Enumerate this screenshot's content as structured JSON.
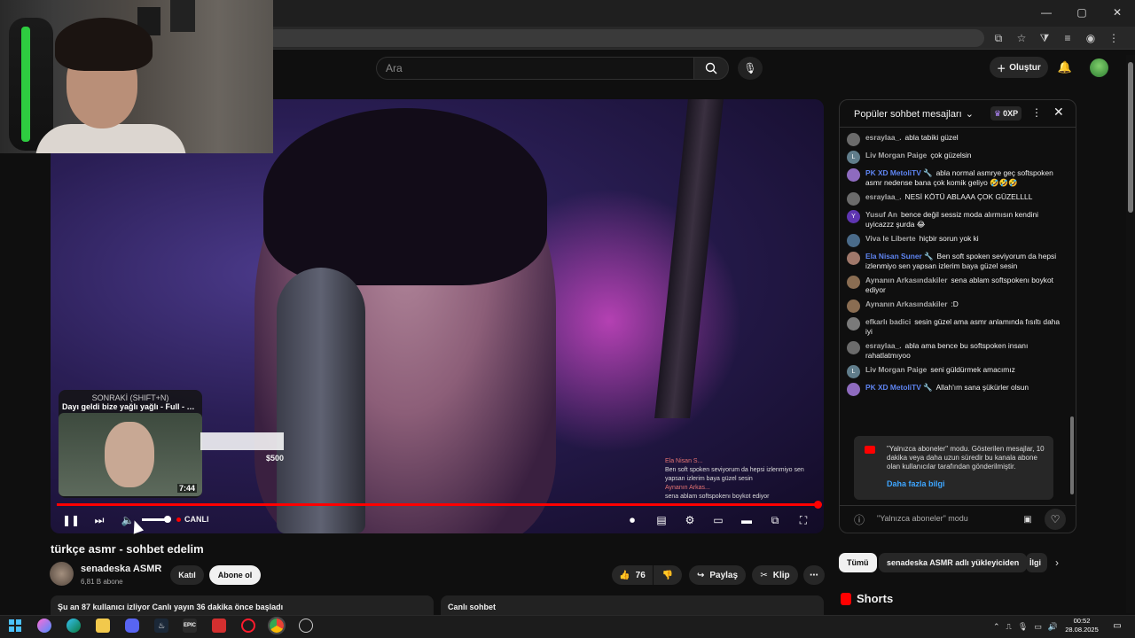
{
  "browser": {
    "window_controls": [
      "—",
      "▢",
      "✕"
    ]
  },
  "header": {
    "search_placeholder": "Ara",
    "create_label": "Oluştur"
  },
  "player": {
    "next_label": "SONRAKİ (SHIFT+N)",
    "next_title": "Dayı geldi bize yağlı yağlı - Full - Jorda...",
    "next_duration": "7:44",
    "overlay_amount": "$500",
    "overlay_ticker": [
      "Ela Nisan S...",
      "Ben soft spoken seviyorum da hepsi izlenmiyo sen yapsan izlerim baya güzel sesin",
      "Aynanın Arkas...",
      "sena ablam softspokenı boykot ediyor"
    ],
    "live_label": "CANLI",
    "progress": 1.0,
    "volume": 0.8
  },
  "video": {
    "title": "türkçe asmr - sohbet edelim",
    "channel": "senadeska ASMR",
    "subscribers": "6,81 B abone",
    "join_label": "Katıl",
    "subscribe_label": "Abone ol",
    "likes": "76",
    "share_label": "Paylaş",
    "clip_label": "Klip",
    "viewers_text": "Şu an 87 kullanıcı izliyor  Canlı yayın 36 dakika önce başladı",
    "live_chat_label": "Canlı sohbet"
  },
  "chat": {
    "title": "Popüler sohbet mesajları",
    "xp": "0XP",
    "messages": [
      {
        "author": "esraylaa_.",
        "text": "abla tabiki güzel",
        "avatar": "",
        "mod": false,
        "color": "#6b6b6b"
      },
      {
        "author": "Liv Morgan Paige",
        "text": "çok güzelsin",
        "avatar": "L",
        "mod": false,
        "color": "#607d8b"
      },
      {
        "author": "PK XD MetoliTV 🔧",
        "text": "abla normal asmrye geç softspoken asmr nedense bana çok komik geliyo 🤣🤣🤣",
        "avatar": "",
        "mod": true,
        "color": "#8e6bbf"
      },
      {
        "author": "esraylaa_.",
        "text": "NESİ KÖTÜ ABLAAA ÇOK GÜZELLLL",
        "avatar": "",
        "mod": false,
        "color": "#6b6b6b"
      },
      {
        "author": "Yusuf An",
        "text": "bence değil sessiz moda alırmısın kendini uyicazzz şurda 😂",
        "avatar": "Y",
        "mod": false,
        "color": "#5e35b1"
      },
      {
        "author": "Viva le Liberte",
        "text": "hiçbir sorun yok ki",
        "avatar": "",
        "mod": false,
        "color": "#4a6b8a"
      },
      {
        "author": "Ela Nisan Suner 🔧",
        "text": "Ben soft spoken seviyorum da hepsi izlenmiyo sen yapsan izlerim baya güzel sesin",
        "avatar": "",
        "mod": true,
        "color": "#a0786a"
      },
      {
        "author": "Aynanın Arkasındakiler",
        "text": "sena ablam softspokenı boykot ediyor",
        "avatar": "",
        "mod": false,
        "color": "#8a6d52"
      },
      {
        "author": "Aynanın Arkasındakiler",
        "text": ":D",
        "avatar": "",
        "mod": false,
        "color": "#8a6d52"
      },
      {
        "author": "efkarlı badici",
        "text": "sesin güzel ama asmr anlamında fısıltı daha iyi",
        "avatar": "",
        "mod": false,
        "color": "#7a7a7a"
      },
      {
        "author": "esraylaa_.",
        "text": "abla ama bence bu softspoken insanı rahatlatmıyoo",
        "avatar": "",
        "mod": false,
        "color": "#6b6b6b"
      },
      {
        "author": "Liv Morgan Paige",
        "text": "seni güldürmek amacımız",
        "avatar": "L",
        "mod": false,
        "color": "#607d8b"
      },
      {
        "author": "PK XD MetoliTV 🔧",
        "text": "Allah'ım sana şükürler olsun",
        "avatar": "",
        "mod": true,
        "color": "#8e6bbf"
      }
    ],
    "notice_text": "\"Yalnızca aboneler\" modu. Gösterilen mesajlar, 10 dakika veya daha uzun süredir bu kanala abone olan kullanıcılar tarafından gönderilmiştir.",
    "notice_link": "Daha fazla bilgi",
    "footer_text": "\"Yalnızca aboneler\" modu"
  },
  "filters": {
    "chips": [
      "Tümü",
      "senadeska ASMR adlı yükleyiciden",
      "İlgi"
    ],
    "shorts_label": "Shorts"
  },
  "taskbar": {
    "time": "00:52",
    "date": "28.08.2025",
    "apps": [
      {
        "name": "epic",
        "label": "EPIC",
        "color": "#2b2b2b"
      }
    ]
  }
}
